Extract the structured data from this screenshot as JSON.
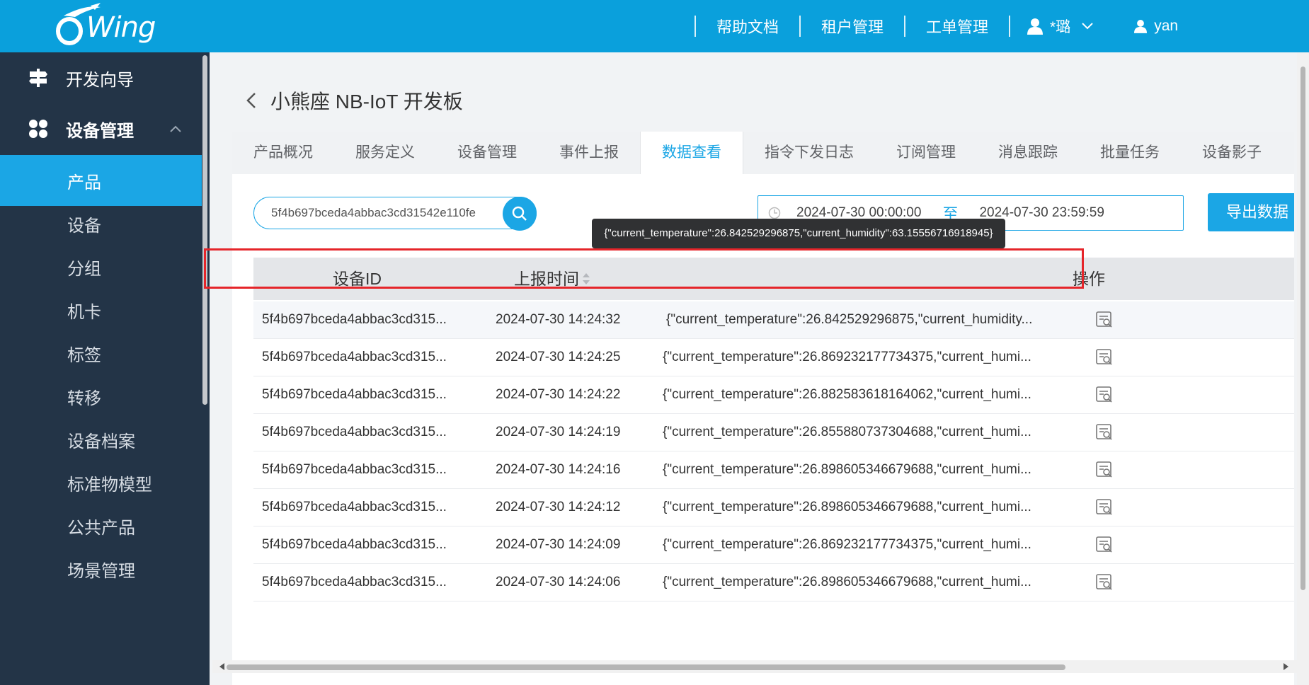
{
  "header": {
    "logo_text": "Wing",
    "nav": [
      "帮助文档",
      "租户管理",
      "工单管理"
    ],
    "user1": "*璐",
    "user2": "yan"
  },
  "sidebar": {
    "sections": [
      {
        "label": "开发向导",
        "icon": "signpost-icon"
      },
      {
        "label": "设备管理",
        "icon": "apps-grid-icon"
      }
    ],
    "items": [
      "产品",
      "设备",
      "分组",
      "机卡",
      "标签",
      "转移",
      "设备档案",
      "标准物模型",
      "公共产品",
      "场景管理"
    ],
    "active_item": "产品"
  },
  "page": {
    "title": "小熊座 NB-IoT 开发板",
    "tabs": [
      "产品概况",
      "服务定义",
      "设备管理",
      "事件上报",
      "数据查看",
      "指令下发日志",
      "订阅管理",
      "消息跟踪",
      "批量任务",
      "设备影子"
    ],
    "active_tab": "数据查看"
  },
  "filters": {
    "search_value": "5f4b697bceda4abbac3cd31542e110fe",
    "date_start": "2024-07-30 00:00:00",
    "date_sep": "至",
    "date_end": "2024-07-30 23:59:59",
    "export_label": "导出数据"
  },
  "table": {
    "columns": [
      "设备ID",
      "上报时间",
      "操作"
    ],
    "tooltip": "{\"current_temperature\":26.842529296875,\"current_humidity\":63.15556716918945}",
    "rows": [
      {
        "id": "5f4b697bceda4abbac3cd315...",
        "time": "2024-07-30 14:24:32",
        "data": "{\"current_temperature\":26.842529296875,\"current_humidity..."
      },
      {
        "id": "5f4b697bceda4abbac3cd315...",
        "time": "2024-07-30 14:24:25",
        "data": "{\"current_temperature\":26.869232177734375,\"current_humi..."
      },
      {
        "id": "5f4b697bceda4abbac3cd315...",
        "time": "2024-07-30 14:24:22",
        "data": "{\"current_temperature\":26.882583618164062,\"current_humi..."
      },
      {
        "id": "5f4b697bceda4abbac3cd315...",
        "time": "2024-07-30 14:24:19",
        "data": "{\"current_temperature\":26.855880737304688,\"current_humi..."
      },
      {
        "id": "5f4b697bceda4abbac3cd315...",
        "time": "2024-07-30 14:24:16",
        "data": "{\"current_temperature\":26.898605346679688,\"current_humi..."
      },
      {
        "id": "5f4b697bceda4abbac3cd315...",
        "time": "2024-07-30 14:24:12",
        "data": "{\"current_temperature\":26.898605346679688,\"current_humi..."
      },
      {
        "id": "5f4b697bceda4abbac3cd315...",
        "time": "2024-07-30 14:24:09",
        "data": "{\"current_temperature\":26.869232177734375,\"current_humi..."
      },
      {
        "id": "5f4b697bceda4abbac3cd315...",
        "time": "2024-07-30 14:24:06",
        "data": "{\"current_temperature\":26.898605346679688,\"current_humi..."
      }
    ]
  }
}
